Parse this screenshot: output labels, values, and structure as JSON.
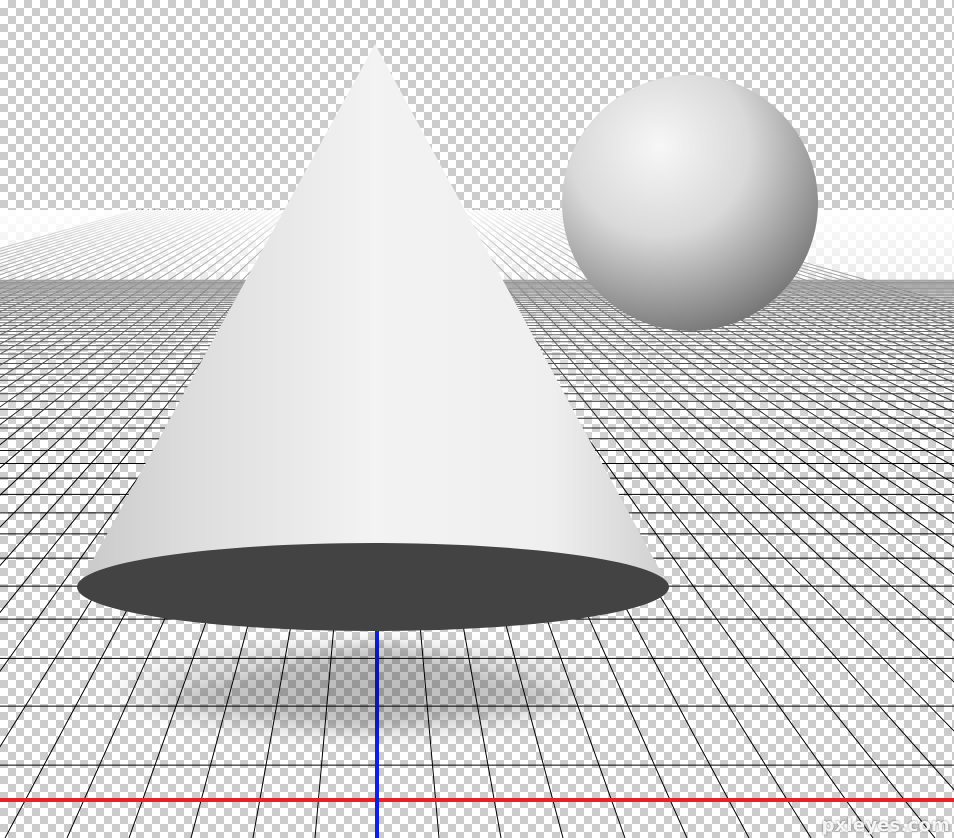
{
  "scene": {
    "objects": [
      "cone",
      "sphere"
    ],
    "ground": "perspective-grid",
    "background": "transparency-checkerboard"
  },
  "colors": {
    "grid_line": "#000000",
    "x_axis": "#e8202a",
    "z_axis": "#1020e0",
    "cone_base": "#434343",
    "object_light": "#f6f6f6",
    "object_dark": "#7d7d7d"
  },
  "watermark": "pxleyes.com"
}
